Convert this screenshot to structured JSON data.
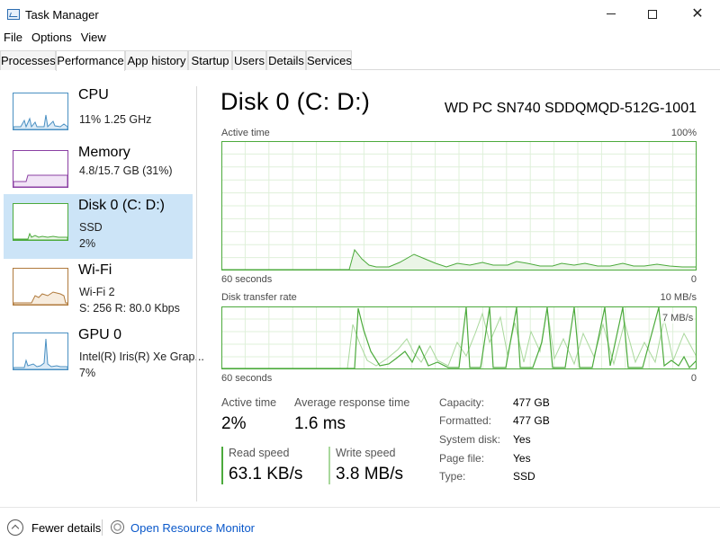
{
  "window": {
    "title": "Task Manager"
  },
  "menu": [
    "File",
    "Options",
    "View"
  ],
  "tabs": [
    "Processes",
    "Performance",
    "App history",
    "Startup",
    "Users",
    "Details",
    "Services"
  ],
  "active_tab": "Performance",
  "sidebar": {
    "items": [
      {
        "title": "CPU",
        "line1": "11%  1.25 GHz",
        "line2": "",
        "color": "#4a90c2"
      },
      {
        "title": "Memory",
        "line1": "4.8/15.7 GB (31%)",
        "line2": "",
        "color": "#8b3fa3"
      },
      {
        "title": "Disk 0 (C: D:)",
        "line1": "SSD",
        "line2": "2%",
        "color": "#4caa3c"
      },
      {
        "title": "Wi-Fi",
        "line1": "Wi-Fi 2",
        "line2": "S: 256  R: 80.0 Kbps",
        "color": "#b07a3c"
      },
      {
        "title": "GPU 0",
        "line1": "Intel(R) Iris(R) Xe Grap...",
        "line2": "7%",
        "color": "#4a90c2"
      }
    ]
  },
  "main": {
    "title": "Disk 0 (C: D:)",
    "model": "WD PC SN740 SDDQMQD-512G-1001",
    "chart1": {
      "label": "Active time",
      "max_label": "100%",
      "time_label": "60 seconds",
      "min_label": "0"
    },
    "chart2": {
      "label": "Disk transfer rate",
      "max_label": "10 MB/s",
      "secondary_label": "7 MB/s",
      "time_label": "60 seconds",
      "min_label": "0"
    },
    "stats": {
      "active_time_label": "Active time",
      "active_time_value": "2%",
      "response_label": "Average response time",
      "response_value": "1.6 ms",
      "read_label": "Read speed",
      "read_value": "63.1 KB/s",
      "write_label": "Write speed",
      "write_value": "3.8 MB/s"
    },
    "properties": [
      {
        "label": "Capacity:",
        "value": "477 GB"
      },
      {
        "label": "Formatted:",
        "value": "477 GB"
      },
      {
        "label": "System disk:",
        "value": "Yes"
      },
      {
        "label": "Page file:",
        "value": "Yes"
      },
      {
        "label": "Type:",
        "value": "SSD"
      }
    ]
  },
  "footer": {
    "fewer_details": "Fewer details",
    "open_monitor": "Open Resource Monitor"
  },
  "colors": {
    "disk_green": "#4caa3c",
    "disk_fill": "#eaf5e6",
    "grid": "#dff0da",
    "selection": "#cce4f7",
    "link": "#0a58ca"
  }
}
